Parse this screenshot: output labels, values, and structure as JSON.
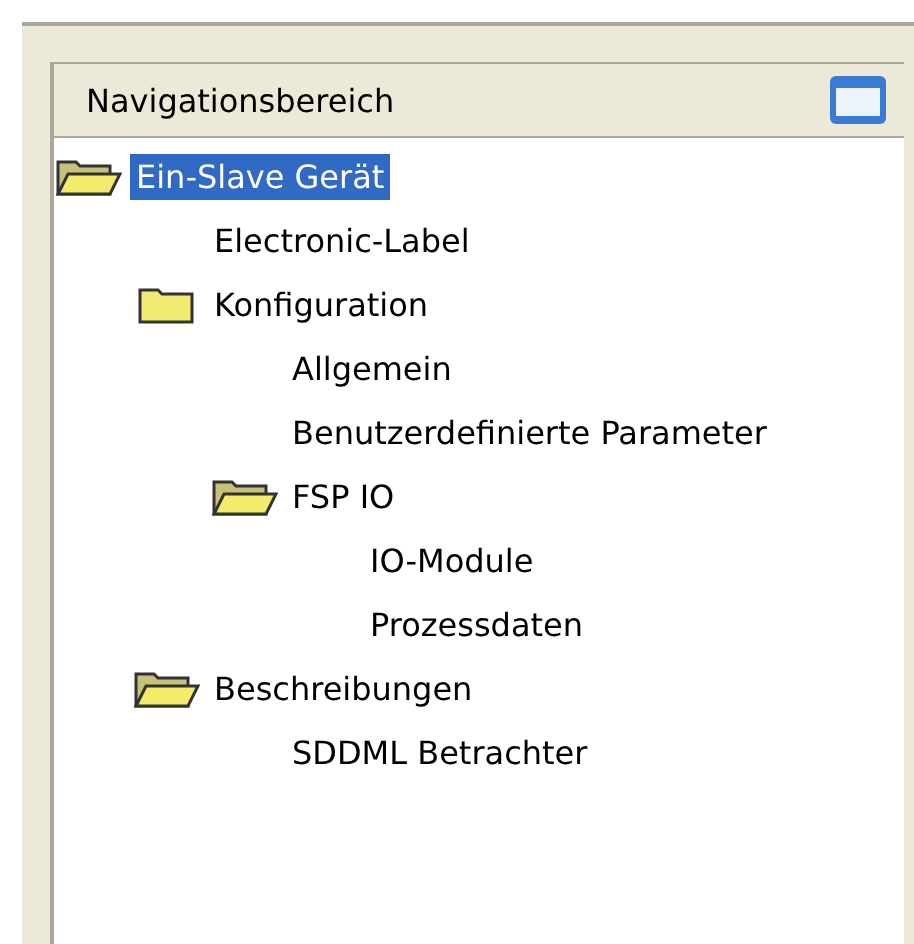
{
  "panel": {
    "title": "Navigationsbereich"
  },
  "tree": [
    {
      "label": "Ein-Slave Gerät",
      "selected": true,
      "expanded": true,
      "children": [
        {
          "label": "Electronic-Label",
          "selected": false
        },
        {
          "label": "Konfiguration",
          "selected": false,
          "expanded": false,
          "children": [
            {
              "label": "Allgemein",
              "selected": false
            },
            {
              "label": "Benutzerdefinierte Parameter",
              "selected": false
            },
            {
              "label": "FSP IO",
              "selected": false,
              "expanded": true,
              "children": [
                {
                  "label": "IO-Module",
                  "selected": false
                },
                {
                  "label": "Prozessdaten",
                  "selected": false
                }
              ]
            }
          ]
        },
        {
          "label": "Beschreibungen",
          "selected": false,
          "expanded": true,
          "children": [
            {
              "label": "SDDML Betrachter",
              "selected": false
            }
          ]
        }
      ]
    }
  ]
}
